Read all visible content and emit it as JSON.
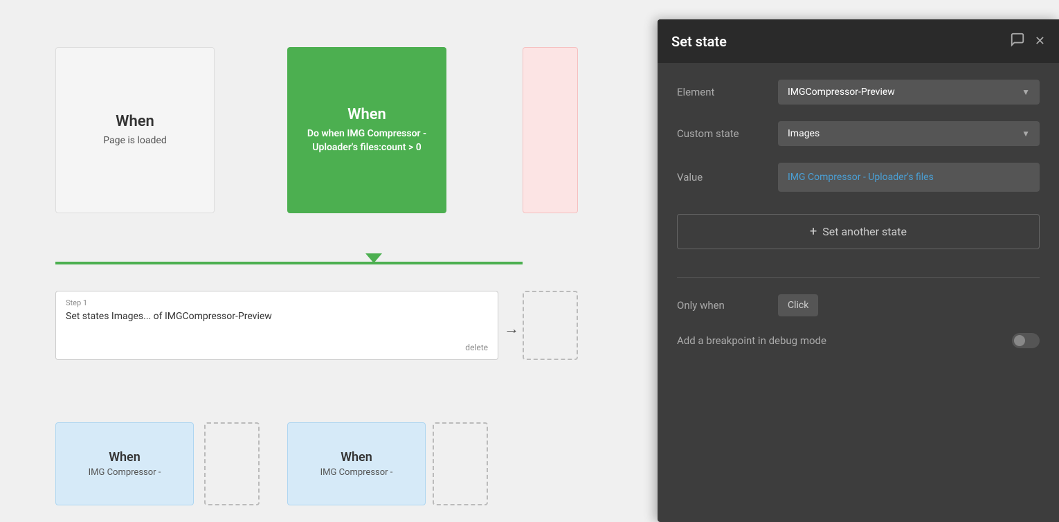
{
  "canvas": {
    "background_color": "#f0f0f0"
  },
  "cards": [
    {
      "id": "card-when-1",
      "type": "when",
      "label": "When",
      "description": "Page is loaded",
      "style": "gray"
    },
    {
      "id": "card-when-2",
      "type": "when",
      "label": "When",
      "description": "Do when IMG Compressor - Uploader's files:count > 0",
      "style": "green"
    },
    {
      "id": "card-when-4",
      "type": "when",
      "label": "When",
      "description": "IMG Compressor -",
      "style": "blue"
    },
    {
      "id": "card-when-5",
      "type": "when",
      "label": "When",
      "description": "IMG Compressor -",
      "style": "blue"
    }
  ],
  "step_box": {
    "step_label": "Step 1",
    "step_description": "Set states Images... of IMGCompressor-Preview",
    "delete_label": "delete"
  },
  "panel": {
    "title": "Set state",
    "comment_icon": "💬",
    "close_icon": "✕",
    "fields": [
      {
        "label": "Element",
        "value": "IMGCompressor-Preview",
        "type": "dropdown"
      },
      {
        "label": "Custom state",
        "value": "Images",
        "type": "dropdown"
      },
      {
        "label": "Value",
        "value": "IMG Compressor - Uploader's files",
        "type": "value",
        "color": "blue"
      }
    ],
    "set_another_state_label": "Set another state",
    "only_when_label": "Only when",
    "only_when_value": "Click",
    "breakpoint_label": "Add a breakpoint in debug mode"
  }
}
